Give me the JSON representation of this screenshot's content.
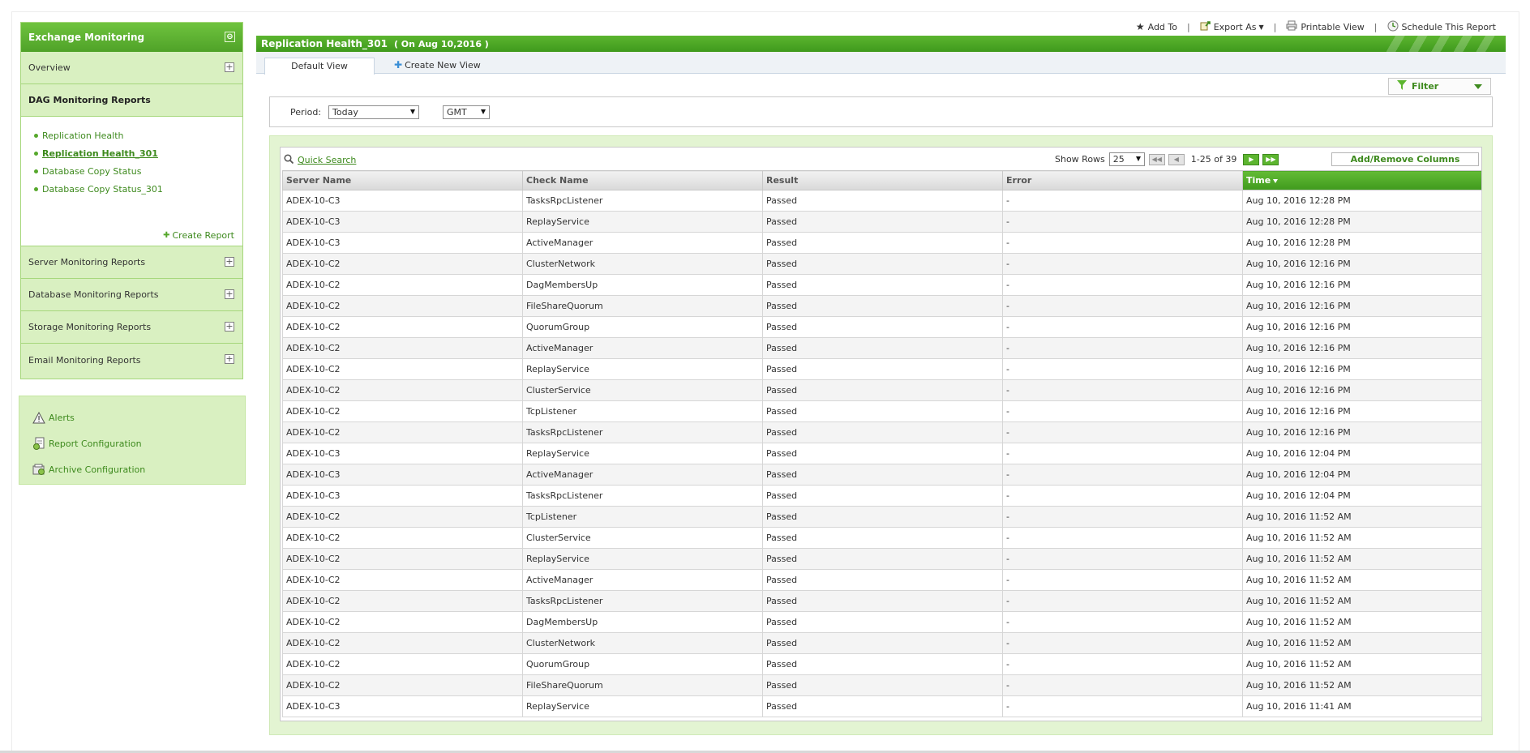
{
  "sidebar": {
    "title": "Exchange Monitoring",
    "sections": {
      "overview": "Overview",
      "dag": "DAG Monitoring Reports",
      "server": "Server Monitoring Reports",
      "database": "Database Monitoring Reports",
      "storage": "Storage Monitoring Reports",
      "email": "Email Monitoring Reports"
    },
    "dag_reports": [
      "Replication Health",
      "Replication Health_301",
      "Database Copy Status",
      "Database Copy Status_301"
    ],
    "create_report": "Create Report",
    "tools": {
      "alerts": "Alerts",
      "report_config": "Report Configuration",
      "archive_config": "Archive Configuration"
    }
  },
  "top_actions": {
    "add_to": "Add To",
    "export_as": "Export As",
    "printable_view": "Printable View",
    "schedule": "Schedule This Report"
  },
  "report": {
    "title": "Replication Health_301",
    "date": "( On Aug 10,2016 )"
  },
  "tabs": {
    "default_view": "Default View",
    "create_new_view": "Create New View"
  },
  "filter": {
    "label": "Filter"
  },
  "period": {
    "label": "Period:",
    "value": "Today",
    "timezone": "GMT"
  },
  "toolbar": {
    "quick_search": "Quick Search",
    "show_rows_label": "Show Rows",
    "rows_value": "25",
    "page_info": "1-25 of 39",
    "add_remove_columns": "Add/Remove Columns"
  },
  "table": {
    "columns": [
      "Server Name",
      "Check Name",
      "Result",
      "Error",
      "Time"
    ],
    "sorted_column": "Time",
    "rows": [
      [
        "ADEX-10-C3",
        "TasksRpcListener",
        "Passed",
        "-",
        "Aug 10, 2016 12:28 PM"
      ],
      [
        "ADEX-10-C3",
        "ReplayService",
        "Passed",
        "-",
        "Aug 10, 2016 12:28 PM"
      ],
      [
        "ADEX-10-C3",
        "ActiveManager",
        "Passed",
        "-",
        "Aug 10, 2016 12:28 PM"
      ],
      [
        "ADEX-10-C2",
        "ClusterNetwork",
        "Passed",
        "-",
        "Aug 10, 2016 12:16 PM"
      ],
      [
        "ADEX-10-C2",
        "DagMembersUp",
        "Passed",
        "-",
        "Aug 10, 2016 12:16 PM"
      ],
      [
        "ADEX-10-C2",
        "FileShareQuorum",
        "Passed",
        "-",
        "Aug 10, 2016 12:16 PM"
      ],
      [
        "ADEX-10-C2",
        "QuorumGroup",
        "Passed",
        "-",
        "Aug 10, 2016 12:16 PM"
      ],
      [
        "ADEX-10-C2",
        "ActiveManager",
        "Passed",
        "-",
        "Aug 10, 2016 12:16 PM"
      ],
      [
        "ADEX-10-C2",
        "ReplayService",
        "Passed",
        "-",
        "Aug 10, 2016 12:16 PM"
      ],
      [
        "ADEX-10-C2",
        "ClusterService",
        "Passed",
        "-",
        "Aug 10, 2016 12:16 PM"
      ],
      [
        "ADEX-10-C2",
        "TcpListener",
        "Passed",
        "-",
        "Aug 10, 2016 12:16 PM"
      ],
      [
        "ADEX-10-C2",
        "TasksRpcListener",
        "Passed",
        "-",
        "Aug 10, 2016 12:16 PM"
      ],
      [
        "ADEX-10-C3",
        "ReplayService",
        "Passed",
        "-",
        "Aug 10, 2016 12:04 PM"
      ],
      [
        "ADEX-10-C3",
        "ActiveManager",
        "Passed",
        "-",
        "Aug 10, 2016 12:04 PM"
      ],
      [
        "ADEX-10-C3",
        "TasksRpcListener",
        "Passed",
        "-",
        "Aug 10, 2016 12:04 PM"
      ],
      [
        "ADEX-10-C2",
        "TcpListener",
        "Passed",
        "-",
        "Aug 10, 2016 11:52 AM"
      ],
      [
        "ADEX-10-C2",
        "ClusterService",
        "Passed",
        "-",
        "Aug 10, 2016 11:52 AM"
      ],
      [
        "ADEX-10-C2",
        "ReplayService",
        "Passed",
        "-",
        "Aug 10, 2016 11:52 AM"
      ],
      [
        "ADEX-10-C2",
        "ActiveManager",
        "Passed",
        "-",
        "Aug 10, 2016 11:52 AM"
      ],
      [
        "ADEX-10-C2",
        "TasksRpcListener",
        "Passed",
        "-",
        "Aug 10, 2016 11:52 AM"
      ],
      [
        "ADEX-10-C2",
        "DagMembersUp",
        "Passed",
        "-",
        "Aug 10, 2016 11:52 AM"
      ],
      [
        "ADEX-10-C2",
        "ClusterNetwork",
        "Passed",
        "-",
        "Aug 10, 2016 11:52 AM"
      ],
      [
        "ADEX-10-C2",
        "QuorumGroup",
        "Passed",
        "-",
        "Aug 10, 2016 11:52 AM"
      ],
      [
        "ADEX-10-C2",
        "FileShareQuorum",
        "Passed",
        "-",
        "Aug 10, 2016 11:52 AM"
      ],
      [
        "ADEX-10-C3",
        "ReplayService",
        "Passed",
        "-",
        "Aug 10, 2016 11:41 AM"
      ]
    ]
  },
  "colors": {
    "brand_green": "#4fa228",
    "link_green": "#3e8a1e",
    "panel_green": "#d9f0c1"
  },
  "icons": {
    "add_to": "star-icon",
    "export": "export-icon",
    "print": "printer-icon",
    "schedule": "clock-icon",
    "filter": "funnel-icon",
    "search": "magnifier-icon",
    "alerts": "warning-icon"
  }
}
